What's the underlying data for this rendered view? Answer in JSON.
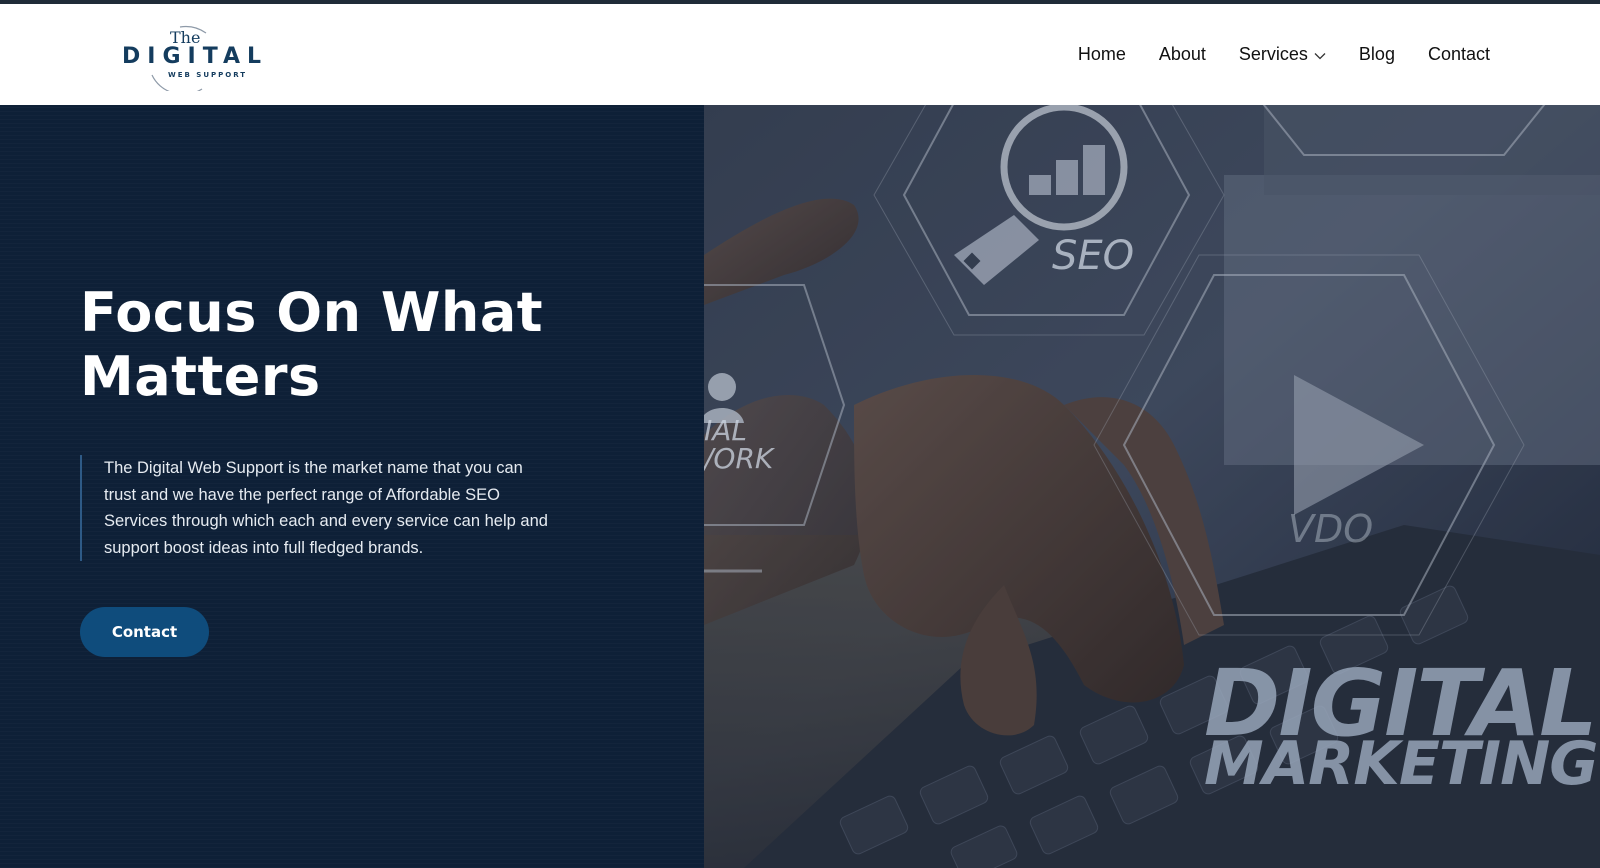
{
  "brand": {
    "logo_the": "The",
    "logo_main": "DIGITAL",
    "logo_sub": "WEB SUPPORT"
  },
  "nav": {
    "items": [
      {
        "label": "Home"
      },
      {
        "label": "About"
      },
      {
        "label": "Services"
      },
      {
        "label": "Blog"
      },
      {
        "label": "Contact"
      }
    ]
  },
  "hero": {
    "title_line1": "Focus On What",
    "title_line2": "Matters",
    "description": "The Digital Web Support is the market name that you can trust and we have the perfect range of Affordable SEO Services through which each and every service can help and support boost ideas into full fledged brands.",
    "cta_label": "Contact",
    "image_labels": {
      "seo": "SEO",
      "social_line1": "IAL",
      "social_line2": "/ORK",
      "vdo": "VDO",
      "digital": "DIGITAL",
      "marketing": "MARKETING"
    }
  },
  "colors": {
    "top_strip": "#1f2b38",
    "hero_left_bg": "#0e2037",
    "cta_bg": "#0f4c7c",
    "logo_text": "#143c5e"
  }
}
